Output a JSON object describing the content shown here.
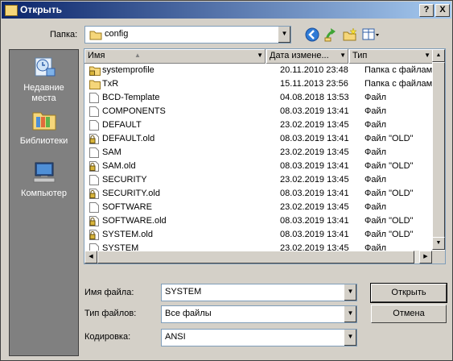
{
  "window": {
    "title": "Открыть",
    "close_label": "X",
    "help_label": "?"
  },
  "folder": {
    "label": "Папка:",
    "value": "config"
  },
  "places": [
    {
      "label": "Недавние места",
      "icon": "recent-places-icon"
    },
    {
      "label": "Библиотеки",
      "icon": "libraries-icon"
    },
    {
      "label": "Компьютер",
      "icon": "computer-icon"
    }
  ],
  "columns": [
    {
      "label": "Имя"
    },
    {
      "label": "Дата измене..."
    },
    {
      "label": "Тип"
    }
  ],
  "files": [
    {
      "name": "systemprofile",
      "date": "20.11.2010 23:48",
      "type": "Папка с файлами",
      "kind": "folder-lock"
    },
    {
      "name": "TxR",
      "date": "15.11.2013 23:56",
      "type": "Папка с файлами",
      "kind": "folder"
    },
    {
      "name": "BCD-Template",
      "date": "04.08.2018 13:53",
      "type": "Файл",
      "kind": "file"
    },
    {
      "name": "COMPONENTS",
      "date": "08.03.2019 13:41",
      "type": "Файл",
      "kind": "file"
    },
    {
      "name": "DEFAULT",
      "date": "23.02.2019 13:45",
      "type": "Файл",
      "kind": "file"
    },
    {
      "name": "DEFAULT.old",
      "date": "08.03.2019 13:41",
      "type": "Файл \"OLD\"",
      "kind": "file-lock"
    },
    {
      "name": "SAM",
      "date": "23.02.2019 13:45",
      "type": "Файл",
      "kind": "file"
    },
    {
      "name": "SAM.old",
      "date": "08.03.2019 13:41",
      "type": "Файл \"OLD\"",
      "kind": "file-lock"
    },
    {
      "name": "SECURITY",
      "date": "23.02.2019 13:45",
      "type": "Файл",
      "kind": "file"
    },
    {
      "name": "SECURITY.old",
      "date": "08.03.2019 13:41",
      "type": "Файл \"OLD\"",
      "kind": "file-lock"
    },
    {
      "name": "SOFTWARE",
      "date": "23.02.2019 13:45",
      "type": "Файл",
      "kind": "file"
    },
    {
      "name": "SOFTWARE.old",
      "date": "08.03.2019 13:41",
      "type": "Файл \"OLD\"",
      "kind": "file-lock"
    },
    {
      "name": "SYSTEM.old",
      "date": "08.03.2019 13:41",
      "type": "Файл \"OLD\"",
      "kind": "file-lock"
    },
    {
      "name": "SYSTEM",
      "date": "23.02.2019 13:45",
      "type": "Файл",
      "kind": "file"
    }
  ],
  "filename": {
    "label": "Имя файла:",
    "value": "SYSTEM"
  },
  "filetype": {
    "label": "Тип файлов:",
    "value": "Все файлы"
  },
  "encoding": {
    "label": "Кодировка:",
    "value": "ANSI"
  },
  "buttons": {
    "open": "Открыть",
    "cancel": "Отмена"
  },
  "colors": {
    "title_start": "#0a246a",
    "title_end": "#a6caf0",
    "dialog_bg": "#d4d0c8",
    "places_bg": "#808080",
    "folder": "#f5d67a",
    "back_arrow": "#2f7bd6",
    "up_arrow": "#3fa535"
  }
}
